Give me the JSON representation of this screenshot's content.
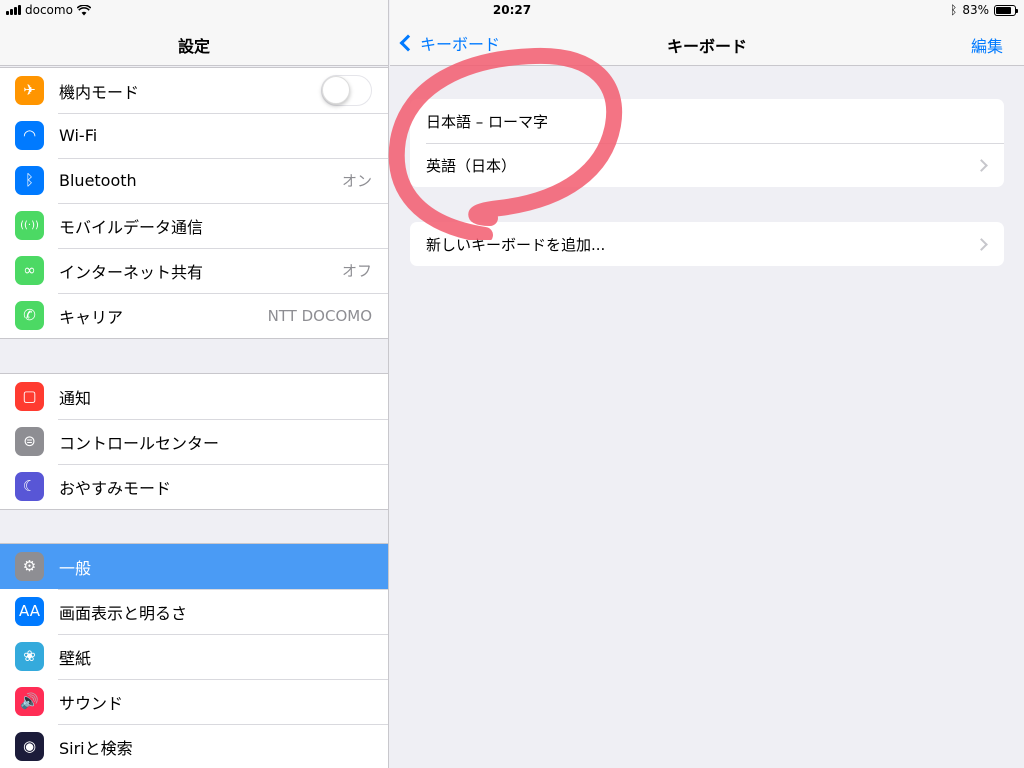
{
  "status": {
    "carrier": "docomo",
    "time": "20:27",
    "battery": "83%",
    "battery_level": 0.83
  },
  "left": {
    "title": "設定",
    "group1": [
      {
        "label": "機内モード",
        "icon": "airplane-icon",
        "color": "#ff9500",
        "glyph": "✈",
        "toggle": false
      },
      {
        "label": "Wi-Fi",
        "icon": "wifi-icon",
        "color": "#007aff",
        "glyph": "◠",
        "value": ""
      },
      {
        "label": "Bluetooth",
        "icon": "bluetooth-icon",
        "color": "#007aff",
        "glyph": "ᛒ",
        "value": "オン"
      },
      {
        "label": "モバイルデータ通信",
        "icon": "antenna-icon",
        "color": "#4cd964",
        "glyph": "((·))",
        "value": ""
      },
      {
        "label": "インターネット共有",
        "icon": "hotspot-icon",
        "color": "#4cd964",
        "glyph": "∞",
        "value": "オフ"
      },
      {
        "label": "キャリア",
        "icon": "phone-icon",
        "color": "#4cd964",
        "glyph": "✆",
        "value": "NTT DOCOMO"
      }
    ],
    "group2": [
      {
        "label": "通知",
        "icon": "notification-icon",
        "color": "#ff3b30",
        "glyph": "▢"
      },
      {
        "label": "コントロールセンター",
        "icon": "switches-icon",
        "color": "#8e8e93",
        "glyph": "⊜"
      },
      {
        "label": "おやすみモード",
        "icon": "moon-icon",
        "color": "#5856d6",
        "glyph": "☾"
      }
    ],
    "group3": [
      {
        "label": "一般",
        "icon": "gear-icon",
        "color": "#8e8e93",
        "glyph": "⚙",
        "selected": true
      },
      {
        "label": "画面表示と明るさ",
        "icon": "text-size-icon",
        "color": "#007aff",
        "glyph": "AA"
      },
      {
        "label": "壁紙",
        "icon": "flower-icon",
        "color": "#34aadc",
        "glyph": "❀"
      },
      {
        "label": "サウンド",
        "icon": "speaker-icon",
        "color": "#ff2d55",
        "glyph": "🔊"
      },
      {
        "label": "Siriと検索",
        "icon": "siri-icon",
        "color": "#1c1c3a",
        "glyph": "◉"
      }
    ]
  },
  "right": {
    "back_label": "キーボード",
    "title": "キーボード",
    "edit_label": "編集",
    "keyboards": [
      {
        "label": "日本語 – ローマ字",
        "chevron": false
      },
      {
        "label": "英語（日本）",
        "chevron": true
      }
    ],
    "add_label": "新しいキーボードを追加..."
  },
  "annotation_color": "#f25c6e"
}
